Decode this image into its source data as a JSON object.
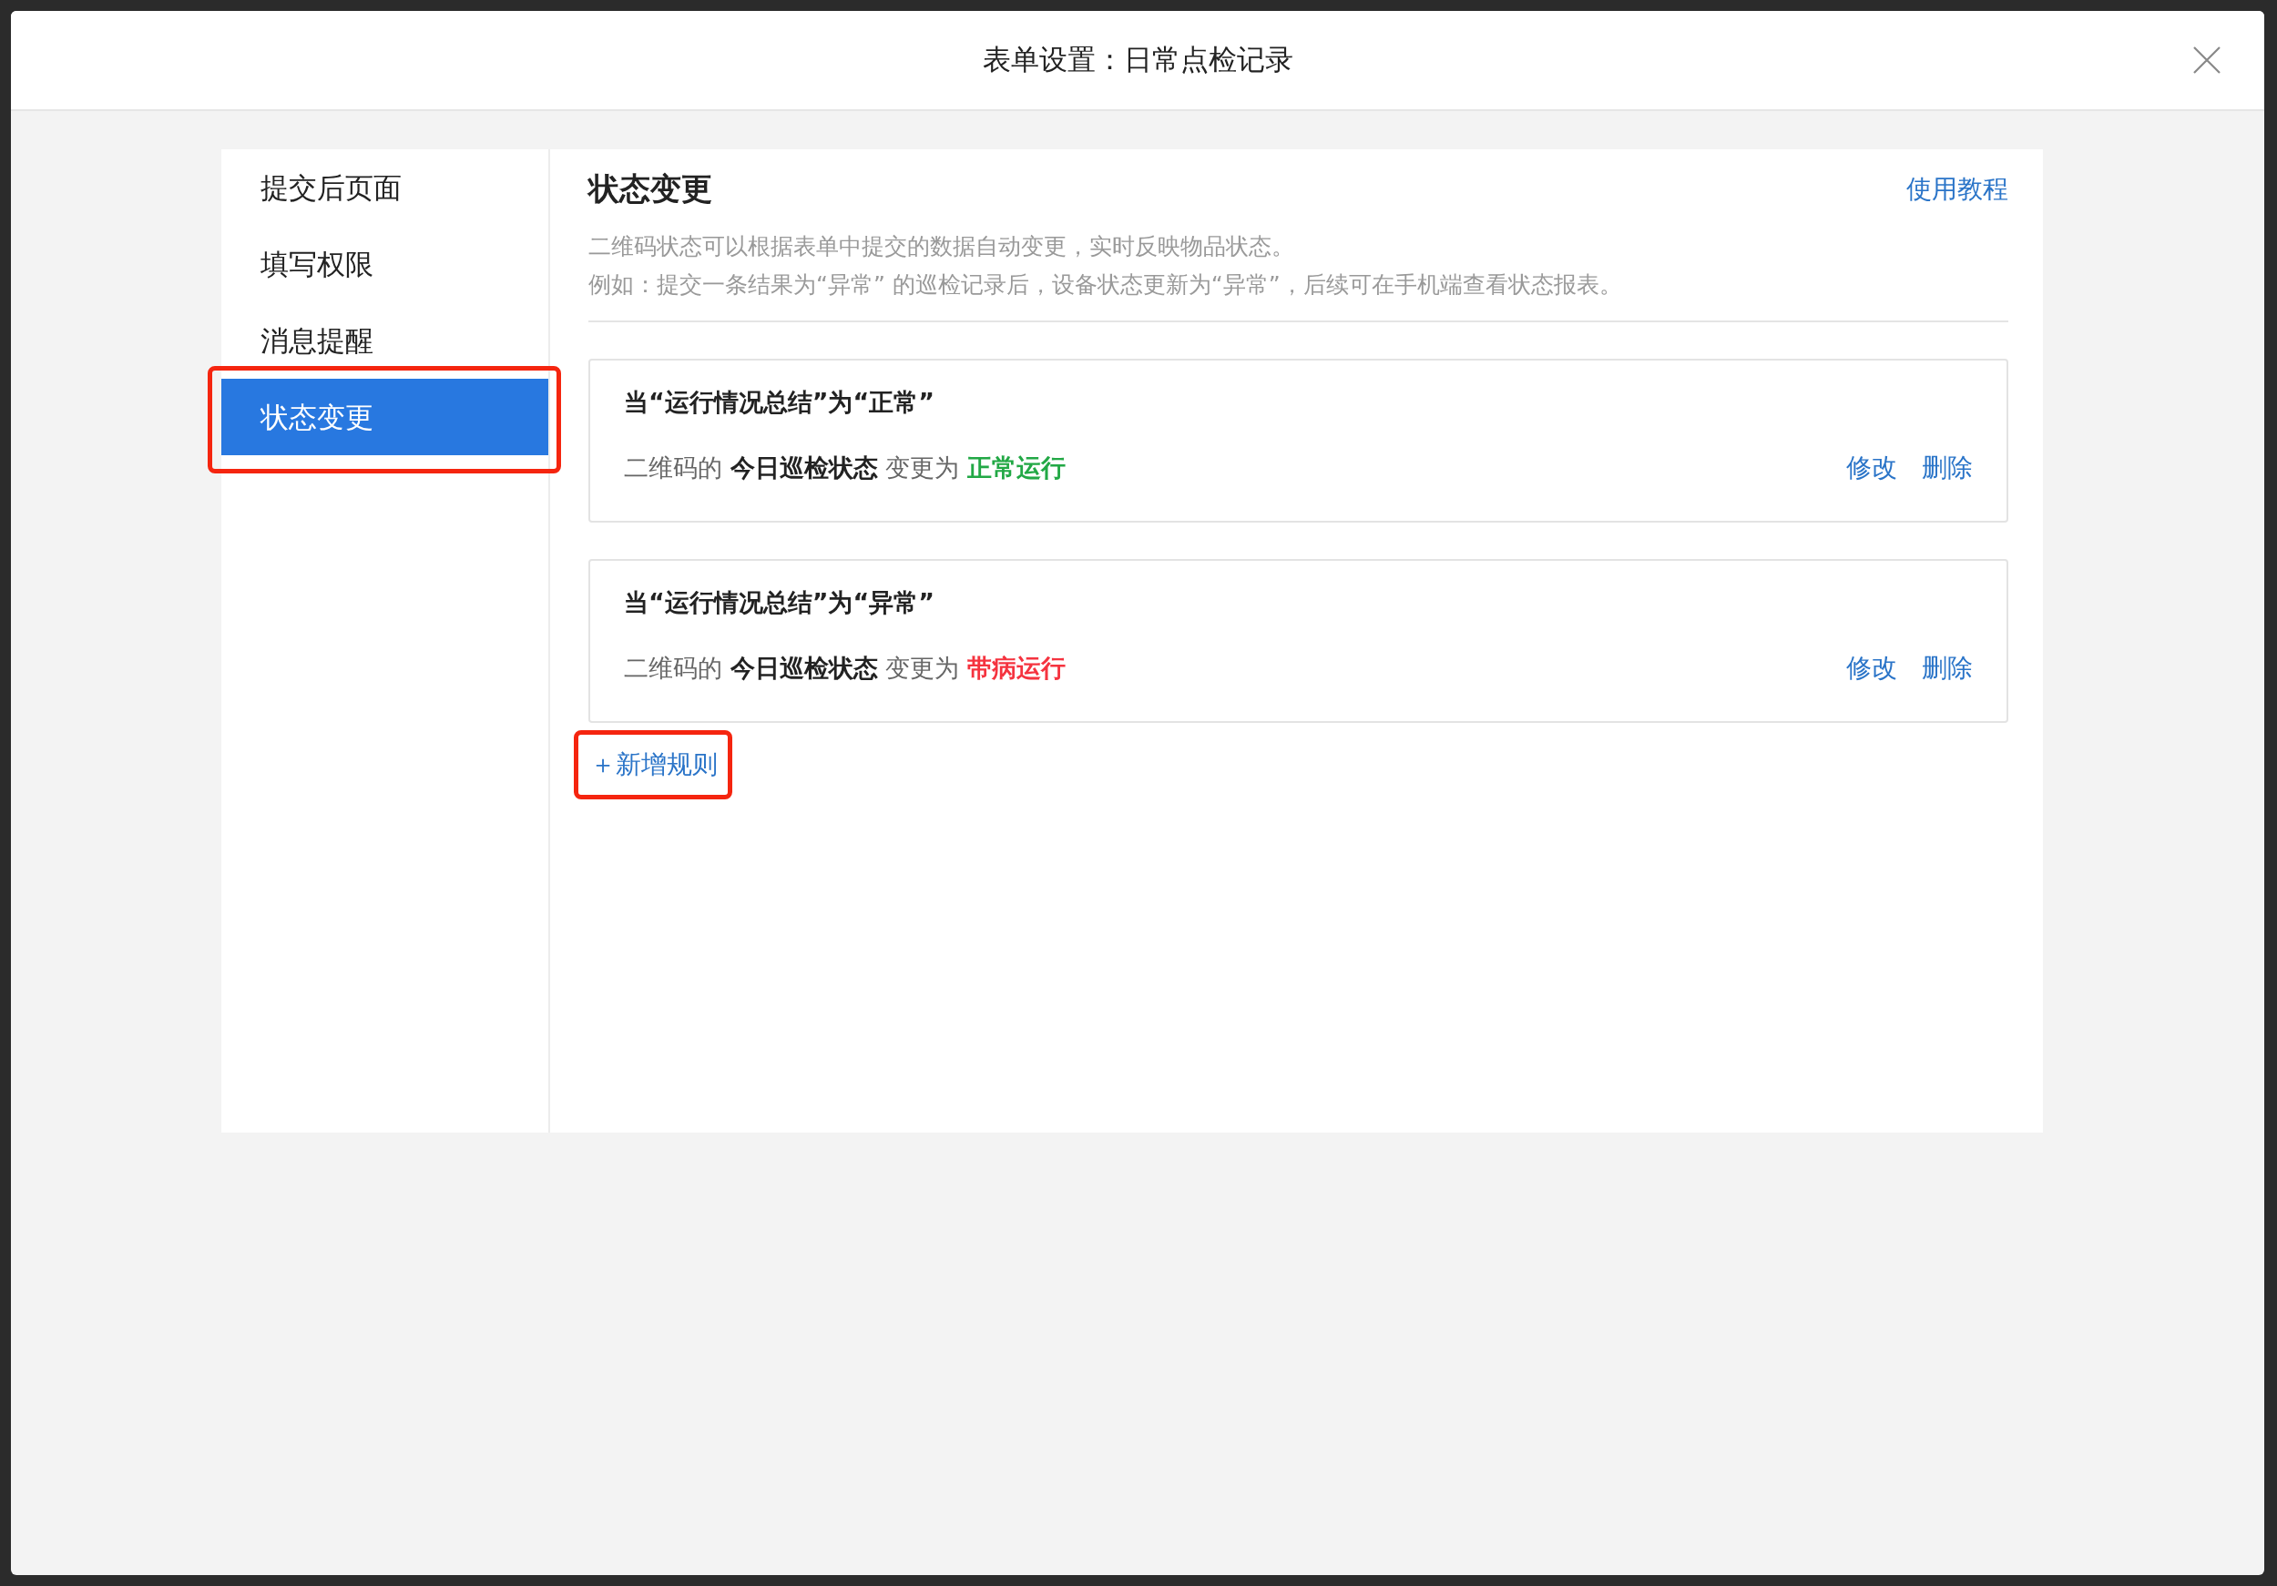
{
  "window": {
    "title": "表单设置：日常点检记录"
  },
  "sidebar": {
    "items": [
      {
        "label": "提交后页面",
        "selected": false,
        "highlighted": false
      },
      {
        "label": "填写权限",
        "selected": false,
        "highlighted": false
      },
      {
        "label": "消息提醒",
        "selected": false,
        "highlighted": false
      },
      {
        "label": "状态变更",
        "selected": true,
        "highlighted": true
      }
    ]
  },
  "section": {
    "title": "状态变更",
    "help_link": "使用教程",
    "description": [
      "二维码状态可以根据表单中提交的数据自动变更，实时反映物品状态。",
      "例如：提交一条结果为“异常” 的巡检记录后，设备状态更新为“异常”，后续可在手机端查看状态报表。"
    ]
  },
  "rules": [
    {
      "condition": "当“运行情况总结”为“正常”",
      "action": "二维码的 **今日巡检状态** 变更为",
      "value": "正常运行",
      "color": "#22a845",
      "actions": [
        "修改",
        "删除"
      ]
    },
    {
      "condition": "当“运行情况总结”为“异常”",
      "action": "二维码的 **今日巡检状态** 变更为",
      "value": "带病运行",
      "color": "#f5333f",
      "actions": [
        "修改",
        "删除"
      ]
    }
  ],
  "add_rule": {
    "label": "＋新增规则",
    "highlighted": true
  }
}
